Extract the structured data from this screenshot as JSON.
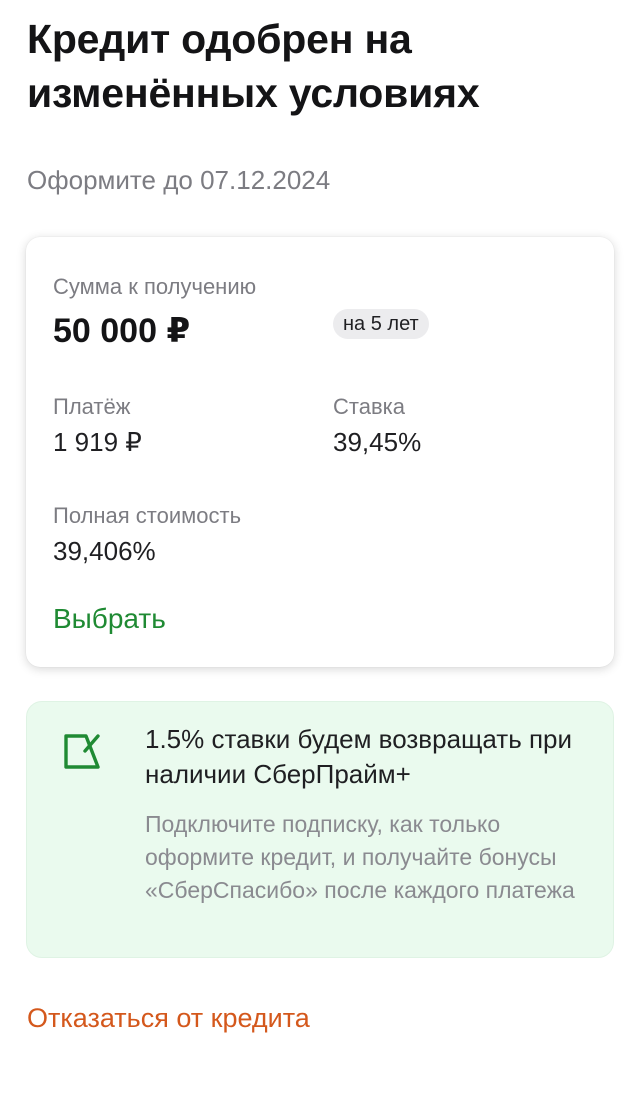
{
  "header": {
    "title": "Кредит одобрен на изменённых условиях",
    "deadline": "Оформите до 07.12.2024"
  },
  "offer": {
    "amount_label": "Сумма к получению",
    "amount_value": "50 000 ₽",
    "term_badge": "на 5 лет",
    "payment_label": "Платёж",
    "payment_value": "1 919 ₽",
    "rate_label": "Ставка",
    "rate_value": "39,45%",
    "full_cost_label": "Полная стоимость",
    "full_cost_value": "39,406%",
    "select_label": "Выбрать"
  },
  "promo": {
    "icon": "sberprime-flag-icon",
    "title": "1.5% ставки будем возвращать при наличии СберПрайм+",
    "description": "Подключите подписку, как только оформите кредит, и получайте бонусы «СберСпасибо» после каждого платежа"
  },
  "actions": {
    "decline_label": "Отказаться от кредита"
  },
  "colors": {
    "accent_green": "#1f8a33",
    "promo_background": "#eafaee",
    "decline_orange": "#d4581c"
  }
}
